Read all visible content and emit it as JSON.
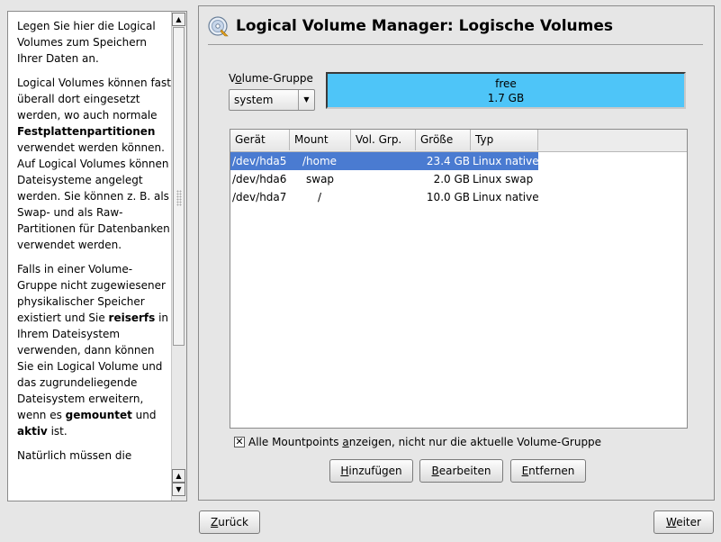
{
  "help": {
    "paragraphs": [
      [
        {
          "t": "Legen Sie hier die Logical Volumes zum Speichern Ihrer Daten an."
        }
      ],
      [
        {
          "t": "Logical Volumes können fast überall dort eingesetzt werden, wo auch normale "
        },
        {
          "t": "Festplattenpartitionen",
          "b": true
        },
        {
          "t": " verwendet werden können. Auf Logical Volumes können Dateisysteme angelegt werden. Sie können z. B. als Swap- und als Raw-Partitionen für Datenbanken verwendet werden."
        }
      ],
      [
        {
          "t": "Falls in einer Volume-Gruppe nicht zugewiesener physikalischer Speicher existiert und Sie "
        },
        {
          "t": "reiserfs",
          "b": true
        },
        {
          "t": " in Ihrem Dateisystem verwenden, dann können Sie ein Logical Volume und das zugrundeliegende Dateisystem erweitern, wenn es "
        },
        {
          "t": "gemountet",
          "b": true
        },
        {
          "t": " und "
        },
        {
          "t": "aktiv",
          "b": true
        },
        {
          "t": " ist."
        }
      ],
      [
        {
          "t": "Natürlich müssen die"
        }
      ]
    ]
  },
  "header": {
    "title": "Logical Volume Manager: Logische Volumes"
  },
  "volume_group": {
    "label_pre": "V",
    "label_ul": "o",
    "label_post": "lume-Gruppe",
    "selected": "system"
  },
  "free": {
    "label": "free",
    "value": "1.7 GB",
    "color": "#4ec5f8"
  },
  "table": {
    "columns": [
      "Gerät",
      "Mount",
      "Vol. Grp.",
      "Größe",
      "Typ"
    ],
    "rows": [
      {
        "device": "/dev/hda5",
        "mount": "/home",
        "volgrp": "",
        "size": "23.4 GB",
        "type": "Linux native",
        "selected": true
      },
      {
        "device": "/dev/hda6",
        "mount": "swap",
        "volgrp": "",
        "size": "2.0 GB",
        "type": "Linux swap",
        "selected": false
      },
      {
        "device": "/dev/hda7",
        "mount": "/",
        "volgrp": "",
        "size": "10.0 GB",
        "type": "Linux native",
        "selected": false
      }
    ],
    "selection_color": "#4a7bd1"
  },
  "options": {
    "show_all_checked": true,
    "show_all_pre": "Alle Mountpoints ",
    "show_all_ul": "a",
    "show_all_post": "nzeigen, nicht nur die aktuelle Volume-Gruppe"
  },
  "actions": {
    "add": {
      "pre": "",
      "ul": "H",
      "post": "inzufügen"
    },
    "edit": {
      "pre": "",
      "ul": "B",
      "post": "earbeiten"
    },
    "remove": {
      "pre": "",
      "ul": "E",
      "post": "ntfernen"
    }
  },
  "nav": {
    "back": {
      "pre": "",
      "ul": "Z",
      "post": "urück"
    },
    "next": {
      "pre": "",
      "ul": "W",
      "post": "eiter"
    }
  },
  "icons": {
    "title": "lvm-disk-icon",
    "scroll_up": "arrow-up-icon",
    "scroll_down": "arrow-down-icon",
    "combo": "chevron-down-icon"
  }
}
